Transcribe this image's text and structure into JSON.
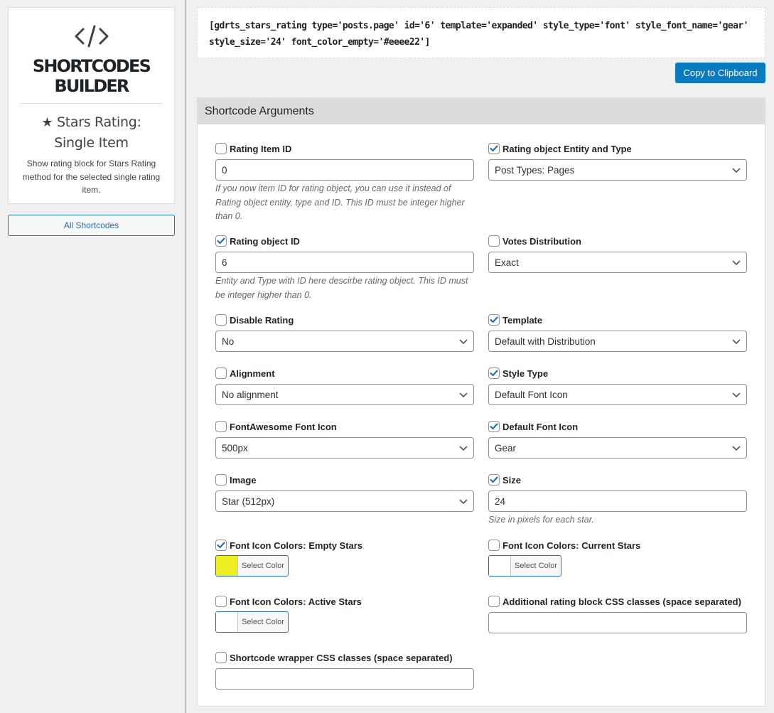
{
  "sidebar": {
    "icon": "code-icon",
    "brand_line1": "SHORTCODES",
    "brand_line2": "BUILDER",
    "shortcode_title_line1": "Stars Rating:",
    "shortcode_title_line2": "Single Item",
    "description": "Show rating block for Stars Rating method for the selected single rating item.",
    "all_shortcodes_label": "All Shortcodes"
  },
  "shortcode_output": "[gdrts_stars_rating type='posts.page' id='6' template='expanded' style_type='font' style_font_name='gear' style_size='24' font_color_empty='#eeee22']",
  "copy_button_label": "Copy to Clipboard",
  "panel_title": "Shortcode Arguments",
  "colors": {
    "accent": "#2271b1",
    "copy_button": "#0a7bc1",
    "empty_stars_color": "#eeee22"
  },
  "fields": {
    "rating_item_id": {
      "label": "Rating Item ID",
      "checked": false,
      "value": "0",
      "hint": "If you now item ID for rating object, you can use it instead of Rating object entity, type and ID. This ID must be integer higher than 0."
    },
    "entity_type": {
      "label": "Rating object Entity and Type",
      "checked": true,
      "value": "Post Types: Pages"
    },
    "rating_object_id": {
      "label": "Rating object ID",
      "checked": true,
      "value": "6",
      "hint": "Entity and Type with ID here descirbe rating object. This ID must be integer higher than 0."
    },
    "votes_distribution": {
      "label": "Votes Distribution",
      "checked": false,
      "value": "Exact"
    },
    "disable_rating": {
      "label": "Disable Rating",
      "checked": false,
      "value": "No"
    },
    "template": {
      "label": "Template",
      "checked": true,
      "value": "Default with Distribution"
    },
    "alignment": {
      "label": "Alignment",
      "checked": false,
      "value": "No alignment"
    },
    "style_type": {
      "label": "Style Type",
      "checked": true,
      "value": "Default Font Icon"
    },
    "fontawesome_icon": {
      "label": "FontAwesome Font Icon",
      "checked": false,
      "value": "500px"
    },
    "default_font_icon": {
      "label": "Default Font Icon",
      "checked": true,
      "value": "Gear"
    },
    "image": {
      "label": "Image",
      "checked": false,
      "value": "Star (512px)"
    },
    "size": {
      "label": "Size",
      "checked": true,
      "value": "24",
      "hint": "Size in pixels for each star."
    },
    "color_empty": {
      "label": "Font Icon Colors: Empty Stars",
      "checked": true,
      "button_label": "Select Color",
      "color": "#eeee22"
    },
    "color_current": {
      "label": "Font Icon Colors: Current Stars",
      "checked": false,
      "button_label": "Select Color",
      "color": ""
    },
    "color_active": {
      "label": "Font Icon Colors: Active Stars",
      "checked": false,
      "button_label": "Select Color",
      "color": ""
    },
    "additional_css": {
      "label": "Additional rating block CSS classes (space separated)",
      "checked": false,
      "value": ""
    },
    "wrapper_css": {
      "label": "Shortcode wrapper CSS classes (space separated)",
      "checked": false,
      "value": ""
    }
  }
}
